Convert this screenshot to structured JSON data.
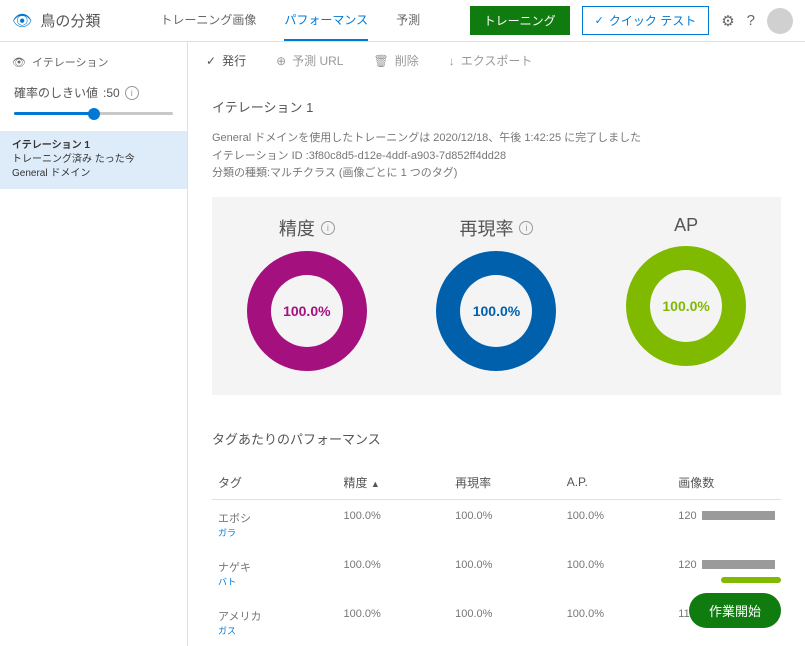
{
  "header": {
    "project_title": "鳥の分類",
    "tabs": {
      "training_images": "トレーニング画像",
      "performance": "パフォーマンス",
      "predict": "予測"
    },
    "train_btn": "トレーニング",
    "quick_test_btn": "クイック テスト"
  },
  "sidebar": {
    "iteration_label": "イテレーション",
    "threshold_label": "確率のしきい値",
    "threshold_value": ":50",
    "iter": {
      "name": "イテレーション 1",
      "line2": "トレーニング済み たった今",
      "line3": "General ドメイン"
    }
  },
  "toolbar": {
    "publish": "発行",
    "pred_url": "予測 URL",
    "delete": "削除",
    "export": "エクスポート"
  },
  "content": {
    "iteration_title": "イテレーション 1",
    "meta_line1": "General ドメインを使用したトレーニングは 2020/12/18、午後 1:42:25 に完了しました",
    "meta_line2": "イテレーション ID :3f80c8d5-d12e-4ddf-a903-7d852ff4dd28",
    "meta_line3": "分類の種類:マルチクラス (画像ごとに 1 つのタグ)"
  },
  "metrics": {
    "precision_label": "精度",
    "recall_label": "再現率",
    "ap_label": "AP",
    "precision_value": "100.0%",
    "recall_value": "100.0%",
    "ap_value": "100.0%"
  },
  "tag_perf": {
    "title": "タグあたりのパフォーマンス",
    "col_tag": "タグ",
    "col_precision": "精度",
    "col_recall": "再現率",
    "col_ap": "A.P.",
    "col_images": "画像数",
    "rows": [
      {
        "name": "エボシ",
        "sub": "ガラ",
        "precision": "100.0%",
        "recall": "100.0%",
        "ap": "100.0%",
        "images": "120"
      },
      {
        "name": "ナゲキ",
        "sub": "バト",
        "precision": "100.0%",
        "recall": "100.0%",
        "ap": "100.0%",
        "images": "120"
      },
      {
        "name": "アメリカ",
        "sub": "ガス",
        "precision": "100.0%",
        "recall": "100.0%",
        "ap": "100.0%",
        "images": "117"
      }
    ]
  },
  "floating": {
    "start_btn": "作業開始"
  },
  "chart_data": [
    {
      "type": "pie",
      "title": "精度",
      "values": [
        100.0
      ],
      "categories": [
        "Precision"
      ],
      "value_label": "100.0%"
    },
    {
      "type": "pie",
      "title": "再現率",
      "values": [
        100.0
      ],
      "categories": [
        "Recall"
      ],
      "value_label": "100.0%"
    },
    {
      "type": "pie",
      "title": "AP",
      "values": [
        100.0
      ],
      "categories": [
        "AP"
      ],
      "value_label": "100.0%"
    }
  ]
}
